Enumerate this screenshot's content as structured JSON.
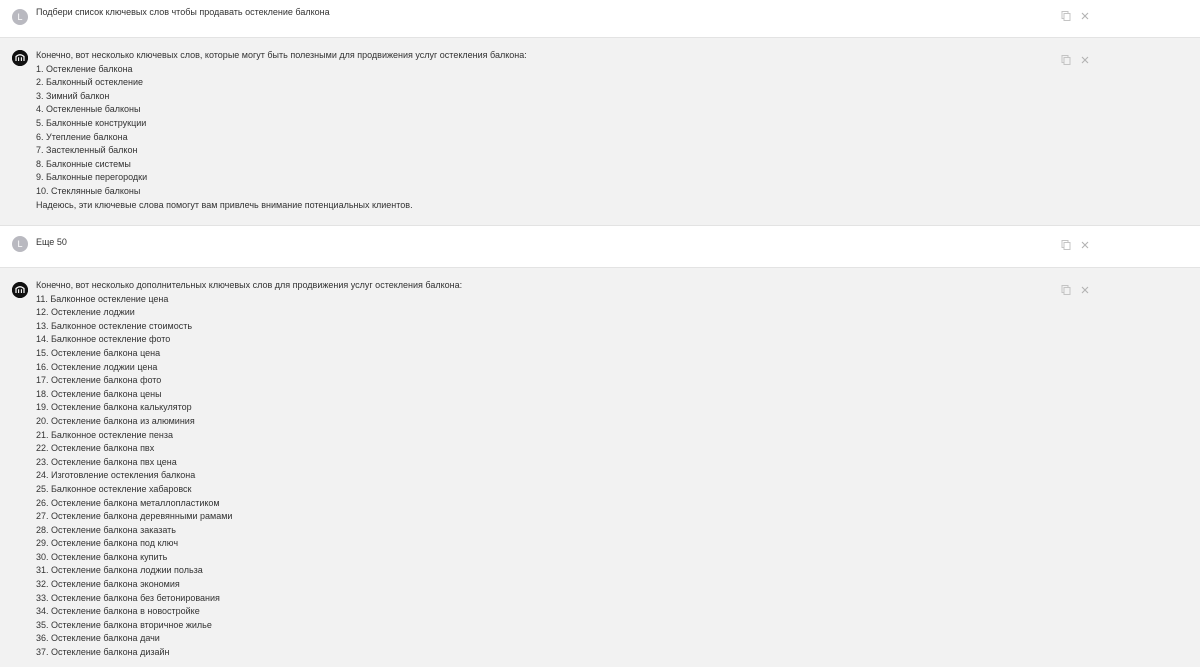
{
  "user_initial": "L",
  "messages": [
    {
      "role": "user",
      "lines": [
        "Подбери список ключевых слов чтобы продавать остекление балкона"
      ]
    },
    {
      "role": "assistant",
      "lines": [
        "Конечно, вот несколько ключевых слов, которые могут быть полезными для продвижения услуг остекления балкона:",
        "1. Остекление балкона",
        "2. Балконный остекление",
        "3. Зимний балкон",
        "4. Остекленные балконы",
        "5. Балконные конструкции",
        "6. Утепление балкона",
        "7. Застекленный балкон",
        "8. Балконные системы",
        "9. Балконные перегородки",
        "10. Стеклянные балконы",
        "Надеюсь, эти ключевые слова помогут вам привлечь внимание потенциальных клиентов."
      ]
    },
    {
      "role": "user",
      "lines": [
        "Еще 50"
      ]
    },
    {
      "role": "assistant",
      "lines": [
        "Конечно, вот несколько дополнительных ключевых слов для продвижения услуг остекления балкона:",
        "11. Балконное остекление цена",
        "12. Остекление лоджии",
        "13. Балконное остекление стоимость",
        "14. Балконное остекление фото",
        "15. Остекление балкона цена",
        "16. Остекление лоджии цена",
        "17. Остекление балкона фото",
        "18. Остекление балкона цены",
        "19. Остекление балкона калькулятор",
        "20. Остекление балкона из алюминия",
        "21. Балконное остекление пенза",
        "22. Остекление балкона пвх",
        "23. Остекление балкона пвх цена",
        "24. Изготовление остекления балкона",
        "25. Балконное остекление хабаровск",
        "26. Остекление балкона металлопластиком",
        "27. Остекление балкона деревянными рамами",
        "28. Остекление балкона заказать",
        "29. Остекление балкона под ключ",
        "30. Остекление балкона купить",
        "31. Остекление балкона лоджии польза",
        "32. Остекление балкона экономия",
        "33. Остекление балкона без бетонирования",
        "34. Остекление балкона в новостройке",
        "35. Остекление балкона вторичное жилье",
        "36. Остекление балкона дачи",
        "37. Остекление балкона дизайн"
      ]
    }
  ],
  "icons": {
    "copy": "copy-icon",
    "close": "close-icon",
    "user_avatar": "user-avatar",
    "bot_avatar": "bot-logo-icon"
  },
  "colors": {
    "user_bg": "#ffffff",
    "assistant_bg": "#f2f2f2",
    "text": "#333333",
    "icon": "#c4c4c4",
    "avatar_user": "#b9b9c0",
    "avatar_bot": "#111111"
  }
}
